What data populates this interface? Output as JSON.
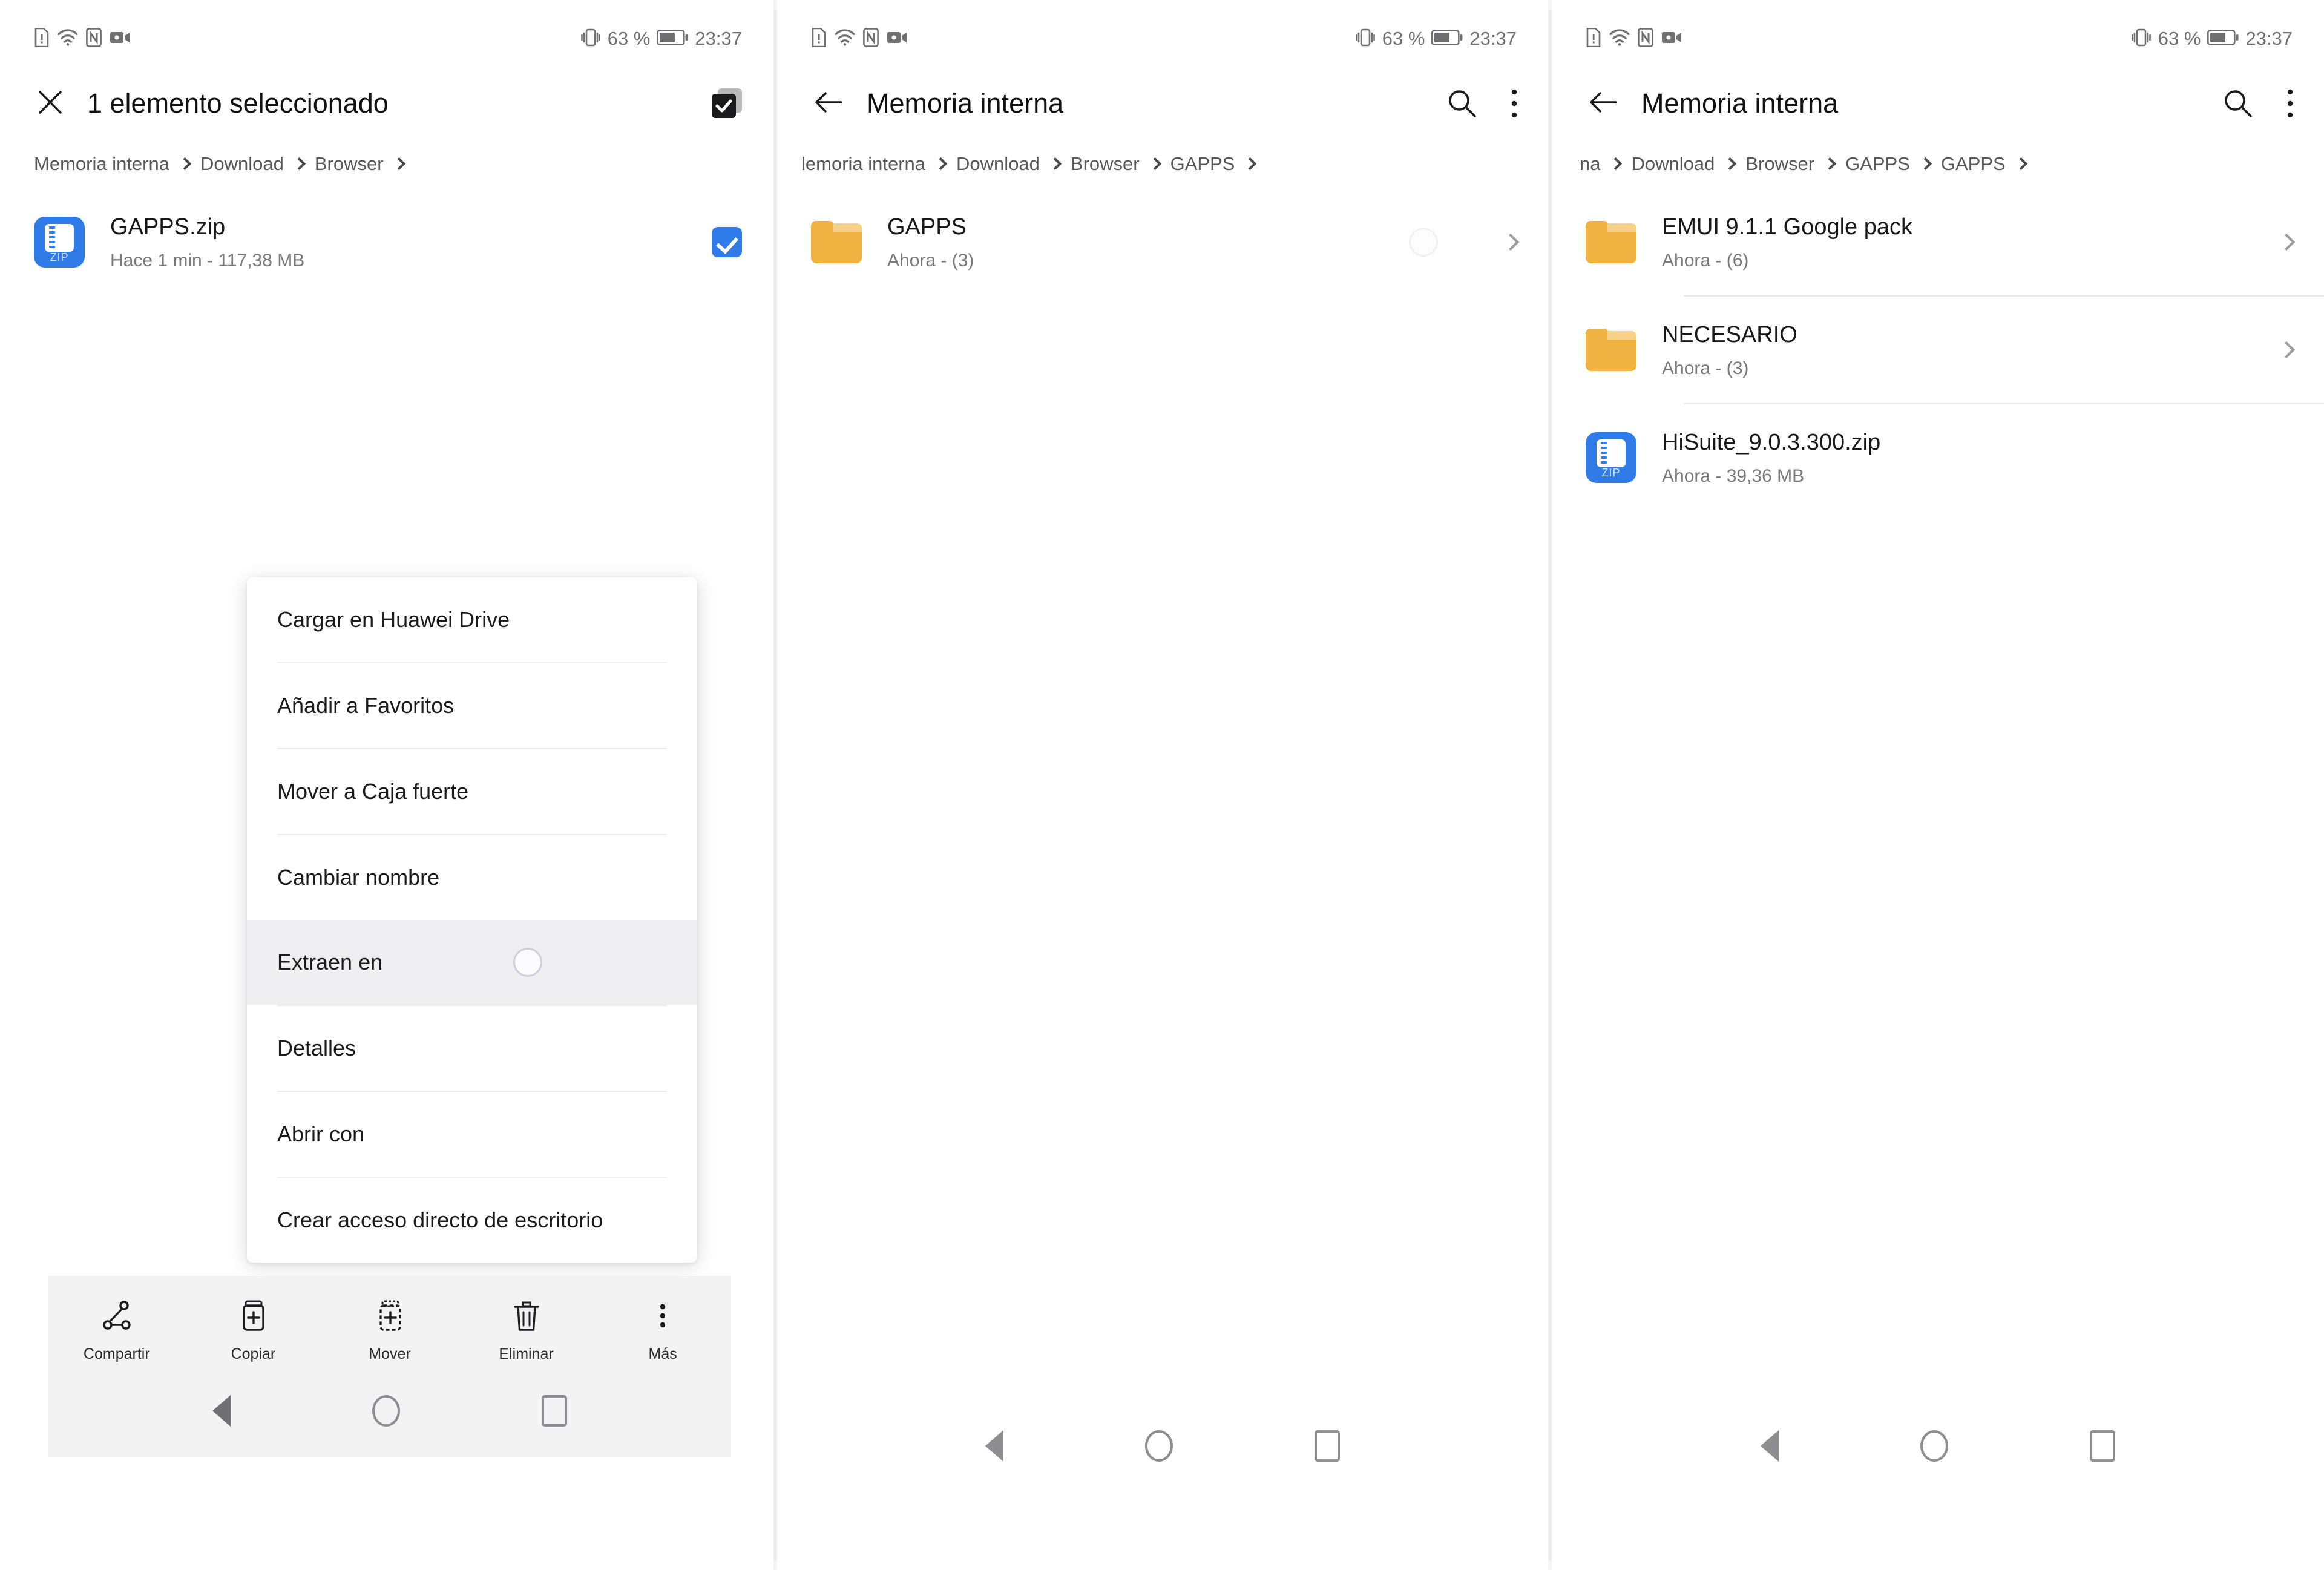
{
  "statusbar": {
    "icons": [
      "sim-alert-icon",
      "wifi-icon",
      "nfc-icon",
      "screen-record-icon"
    ],
    "vibrate_icon": "vibrate-icon",
    "battery_percent": "63 %",
    "battery_level": 63,
    "clock": "23:37"
  },
  "colors": {
    "accent_blue": "#2f7ce8",
    "folder_amber": "#f0b341",
    "menu_highlight": "#efeff1",
    "actionbar_bg": "#f3f3f4",
    "text_primary": "#18181b",
    "text_secondary": "#78787d"
  },
  "panel1": {
    "appbar": {
      "close_icon": "close-icon",
      "title": "1 elemento seleccionado",
      "select_all_icon": "select-all-icon"
    },
    "breadcrumb": [
      "Memoria interna",
      "Download",
      "Browser"
    ],
    "files": [
      {
        "icon": "zip-file-icon",
        "icon_label": "ZIP",
        "name": "GAPPS.zip",
        "meta": "Hace 1 min - 117,38 MB",
        "selected": true
      }
    ],
    "context_menu": [
      {
        "label": "Cargar en Huawei Drive",
        "highlighted": false
      },
      {
        "label": "Añadir a Favoritos",
        "highlighted": false
      },
      {
        "label": "Mover a Caja fuerte",
        "highlighted": false
      },
      {
        "label": "Cambiar nombre",
        "highlighted": false
      },
      {
        "label": "Extraen en",
        "highlighted": true
      },
      {
        "label": "Detalles",
        "highlighted": false
      },
      {
        "label": "Abrir con",
        "highlighted": false
      },
      {
        "label": "Crear acceso directo de escritorio",
        "highlighted": false
      }
    ],
    "actionbar": [
      {
        "icon": "share-icon",
        "label": "Compartir"
      },
      {
        "icon": "copy-icon",
        "label": "Copiar"
      },
      {
        "icon": "move-icon",
        "label": "Mover"
      },
      {
        "icon": "delete-icon",
        "label": "Eliminar"
      },
      {
        "icon": "more-vertical-icon",
        "label": "Más"
      }
    ],
    "navbar": [
      "back-nav-icon",
      "home-nav-icon",
      "recents-nav-icon"
    ]
  },
  "panel2": {
    "appbar": {
      "back_icon": "back-arrow-icon",
      "title": "Memoria interna",
      "search_icon": "search-icon",
      "overflow_icon": "more-vertical-icon"
    },
    "breadcrumb": [
      "lemoria interna",
      "Download",
      "Browser",
      "GAPPS"
    ],
    "files": [
      {
        "icon": "folder-icon",
        "name": "GAPPS",
        "meta": "Ahora - (3)",
        "ripple": true,
        "chevron": true
      }
    ],
    "navbar": [
      "back-nav-icon",
      "home-nav-icon",
      "recents-nav-icon"
    ]
  },
  "panel3": {
    "appbar": {
      "back_icon": "back-arrow-icon",
      "title": "Memoria interna",
      "search_icon": "search-icon",
      "overflow_icon": "more-vertical-icon"
    },
    "breadcrumb": [
      "na",
      "Download",
      "Browser",
      "GAPPS",
      "GAPPS"
    ],
    "files": [
      {
        "icon": "folder-icon",
        "name": "EMUI 9.1.1 Google pack",
        "meta": "Ahora - (6)",
        "chevron": true
      },
      {
        "icon": "folder-icon",
        "name": "NECESARIO",
        "meta": "Ahora - (3)",
        "chevron": true
      },
      {
        "icon": "zip-file-icon",
        "icon_label": "ZIP",
        "name": "HiSuite_9.0.3.300.zip",
        "meta": "Ahora - 39,36 MB",
        "chevron": false
      }
    ],
    "navbar": [
      "back-nav-icon",
      "home-nav-icon",
      "recents-nav-icon"
    ]
  }
}
